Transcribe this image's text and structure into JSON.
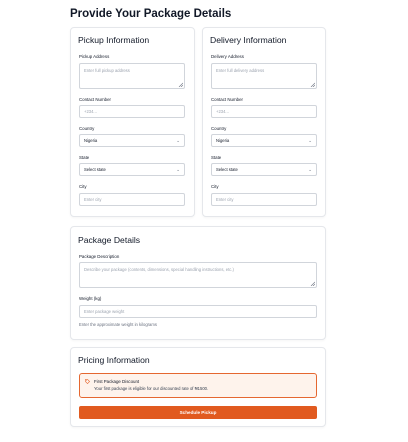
{
  "page": {
    "title": "Provide Your Package Details"
  },
  "pickup": {
    "title": "Pickup Information",
    "address_label": "Pickup Address",
    "address_placeholder": "Enter full pickup address",
    "contact_label": "Contact Number",
    "contact_placeholder": "+234...",
    "country_label": "Country",
    "country_value": "Nigeria",
    "state_label": "State",
    "state_value": "Select state",
    "city_label": "City",
    "city_placeholder": "Enter city"
  },
  "delivery": {
    "title": "Delivery Information",
    "address_label": "Delivery Address",
    "address_placeholder": "Enter full delivery address",
    "contact_label": "Contact Number",
    "contact_placeholder": "+234...",
    "country_label": "Country",
    "country_value": "Nigeria",
    "state_label": "State",
    "state_value": "Select state",
    "city_label": "City",
    "city_placeholder": "Enter city"
  },
  "package": {
    "title": "Package Details",
    "description_label": "Package Description",
    "description_placeholder": "Describe your package (contents, dimensions, special handling instructions, etc.)",
    "weight_label": "Weight (kg)",
    "weight_placeholder": "Enter package weight",
    "weight_hint": "Enter the approximate weight in kilograms"
  },
  "pricing": {
    "title": "Pricing Information",
    "discount_title": "First Package Discount",
    "discount_text": "Your first package is eligible for our discounted rate of ₦1500.",
    "icon": "tag-icon"
  },
  "actions": {
    "submit_label": "Schedule Pickup"
  },
  "colors": {
    "accent": "#e15a1f",
    "discount_bg": "#fef3ec",
    "discount_border": "#e56730"
  }
}
